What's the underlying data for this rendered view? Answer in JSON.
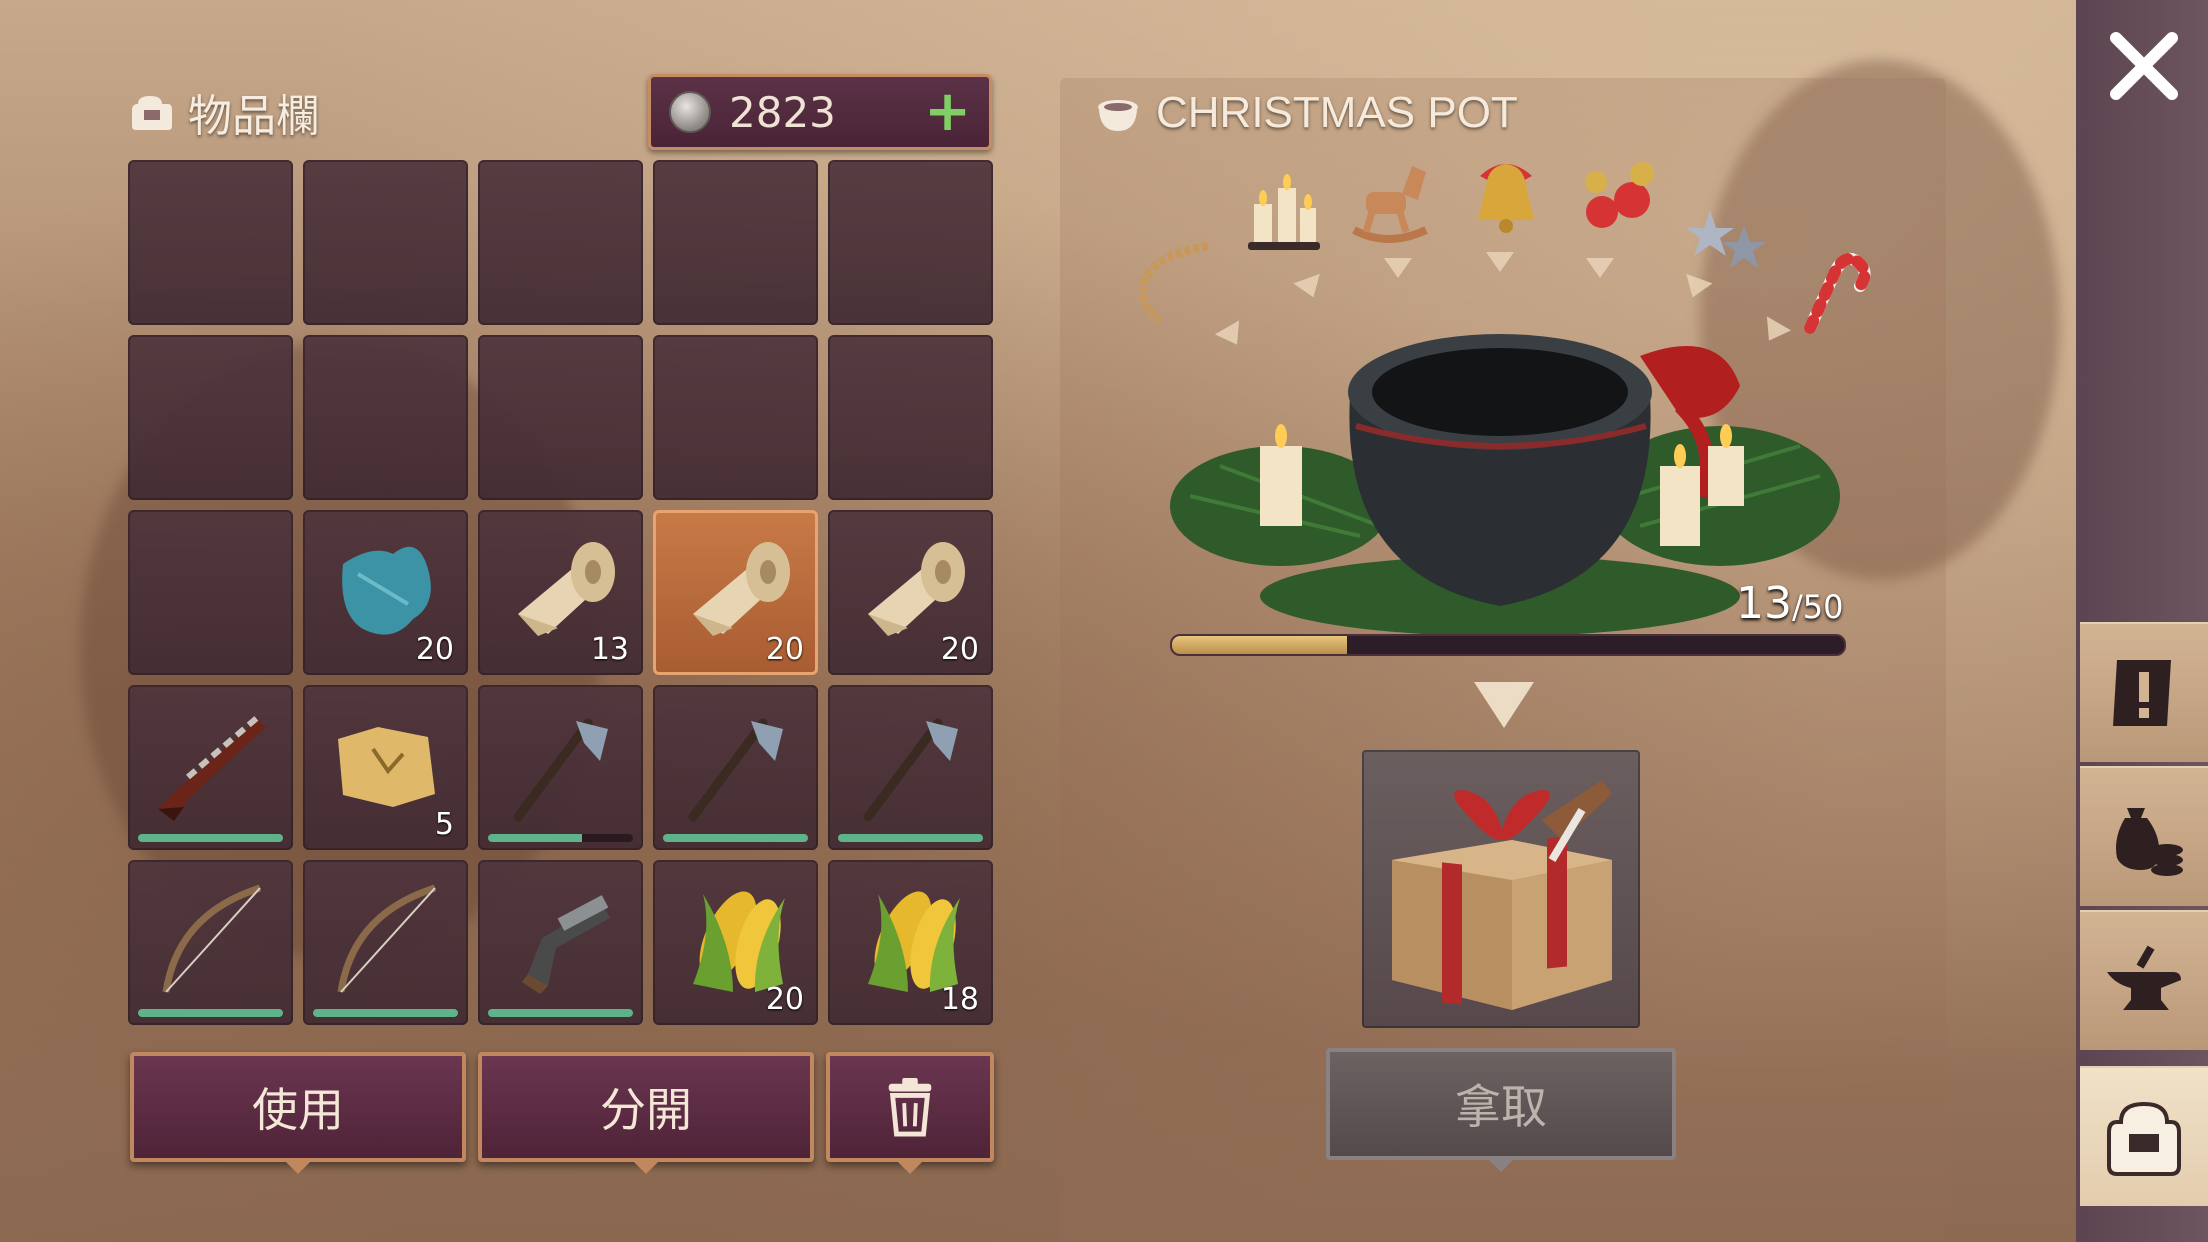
{
  "inventory": {
    "title": "物品欄",
    "currency": "2823",
    "slots": [
      {
        "item": "",
        "qty": ""
      },
      {
        "item": "",
        "qty": ""
      },
      {
        "item": "",
        "qty": ""
      },
      {
        "item": "",
        "qty": ""
      },
      {
        "item": "",
        "qty": ""
      },
      {
        "item": "",
        "qty": ""
      },
      {
        "item": "",
        "qty": ""
      },
      {
        "item": "",
        "qty": ""
      },
      {
        "item": "",
        "qty": ""
      },
      {
        "item": "",
        "qty": ""
      },
      {
        "item": "",
        "qty": ""
      },
      {
        "item": "cloth",
        "qty": "20"
      },
      {
        "item": "scroll",
        "qty": "13"
      },
      {
        "item": "scroll",
        "qty": "20",
        "selected": true
      },
      {
        "item": "scroll",
        "qty": "20"
      },
      {
        "item": "shotgun",
        "qty": "",
        "durability": 1.0
      },
      {
        "item": "map",
        "qty": "5"
      },
      {
        "item": "axe",
        "qty": "",
        "durability": 0.65
      },
      {
        "item": "axe",
        "qty": "",
        "durability": 1.0
      },
      {
        "item": "axe",
        "qty": "",
        "durability": 1.0
      },
      {
        "item": "bow",
        "qty": "",
        "durability": 1.0
      },
      {
        "item": "bow",
        "qty": "",
        "durability": 1.0
      },
      {
        "item": "pistol",
        "qty": "",
        "durability": 1.0
      },
      {
        "item": "corn",
        "qty": "20"
      },
      {
        "item": "corn",
        "qty": "18"
      }
    ],
    "buttons": {
      "use": "使用",
      "split": "分開",
      "trash_icon": "trash-icon"
    }
  },
  "pot": {
    "title": "CHRISTMAS POT",
    "decorations": [
      "garland-icon",
      "candles-icon",
      "rocking-horse-icon",
      "bell-icon",
      "ornaments-icon",
      "stars-icon",
      "candy-cane-icon"
    ],
    "progress_current": "13",
    "progress_max": "/50",
    "progress_fraction": 0.26,
    "reward_icon": "gift-box-icon",
    "take_label": "拿取"
  },
  "sidebar": {
    "tabs": [
      "quest-icon",
      "money-bag-icon",
      "anvil-icon",
      "backpack-icon"
    ],
    "active_tab": "backpack-icon"
  },
  "colors": {
    "accent": "#c1875e",
    "button": "#5a2a42",
    "progress": "#d8b36a",
    "durability": "#5fb38a"
  }
}
